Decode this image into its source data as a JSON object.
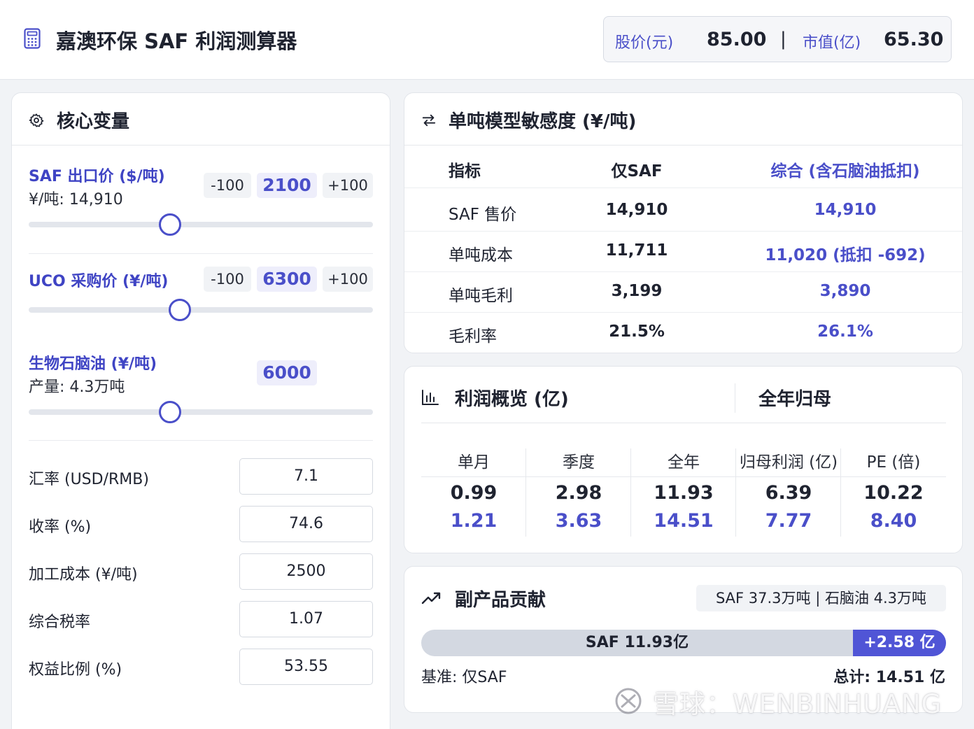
{
  "header": {
    "title": "嘉澳环保 SAF 利润测算器",
    "stock_price_label": "股价(元)",
    "stock_price_value": "85.00",
    "separator": "|",
    "market_cap_label": "市值(亿)",
    "market_cap_value": "65.30"
  },
  "core": {
    "title": "核心变量",
    "saf": {
      "label": "SAF 出口价 ($/吨)",
      "sub": "¥/吨: 14,910",
      "minus": "-100",
      "value": "2100",
      "plus": "+100",
      "slider_fraction": 0.41
    },
    "uco": {
      "label": "UCO 采购价 (¥/吨)",
      "minus": "-100",
      "value": "6300",
      "plus": "+100",
      "slider_fraction": 0.44
    },
    "naphtha": {
      "label": "生物石脑油 (¥/吨)",
      "sub": "产量: 4.3万吨",
      "value": "6000",
      "slider_fraction": 0.41
    },
    "params": [
      {
        "label": "汇率 (USD/RMB)",
        "value": "7.1"
      },
      {
        "label": "收率 (%)",
        "value": "74.6"
      },
      {
        "label": "加工成本 (¥/吨)",
        "value": "2500"
      },
      {
        "label": "综合税率",
        "value": "1.07"
      },
      {
        "label": "权益比例 (%)",
        "value": "53.55"
      }
    ]
  },
  "sensitivity": {
    "title": "单吨模型敏感度 (¥/吨)",
    "headers": [
      "指标",
      "仅SAF",
      "综合 (含石脑油抵扣)"
    ],
    "rows": [
      [
        "SAF 售价",
        "14,910",
        "14,910"
      ],
      [
        "单吨成本",
        "11,711",
        "11,020 (抵扣 -692)"
      ],
      [
        "单吨毛利",
        "3,199",
        "3,890"
      ],
      [
        "毛利率",
        "21.5%",
        "26.1%"
      ]
    ]
  },
  "profit": {
    "title": "利润概览 (亿)",
    "right_title": "全年归母",
    "columns": [
      {
        "header": "单月",
        "v1": "0.99",
        "v2": "1.21"
      },
      {
        "header": "季度",
        "v1": "2.98",
        "v2": "3.63"
      },
      {
        "header": "全年",
        "v1": "11.93",
        "v2": "14.51"
      },
      {
        "header": "归母利润 (亿)",
        "v1": "6.39",
        "v2": "7.77"
      },
      {
        "header": "PE (倍)",
        "v1": "10.22",
        "v2": "8.40"
      }
    ]
  },
  "byproduct": {
    "title": "副产品贡献",
    "tag": "SAF 37.3万吨 | 石脑油 4.3万吨",
    "bar_base_label": "SAF 11.93亿",
    "bar_add_label": "+2.58 亿",
    "bar_base_value": 11.93,
    "bar_add_value": 2.58,
    "footer_left": "基准: 仅SAF",
    "footer_right": "总计: 14.51 亿"
  },
  "watermark": "雪球：WENBINHUANG",
  "colors": {
    "accent": "#4a4fc9",
    "bar_add": "#5055d6",
    "bar_base": "#d3d8e1"
  }
}
